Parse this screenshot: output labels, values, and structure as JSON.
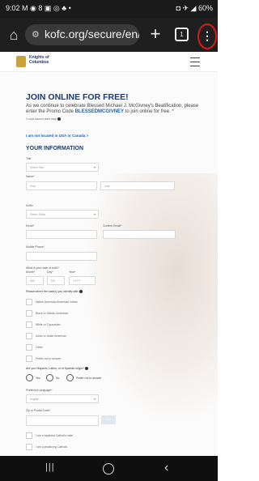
{
  "status_bar": {
    "time": "9:02",
    "left_icons": "M ◉ 8 ▣ ◎ ♣ •",
    "battery": "60%",
    "right_icons": "◘ ✈ ◢"
  },
  "browser": {
    "url": "kofc.org/secure/en/j",
    "url_icon": "site-settings-icon",
    "home_icon": "⌂",
    "new_tab": "+",
    "tab_count": "1",
    "menu": "⋮"
  },
  "site": {
    "logo_text": "Knights of\nColumbus"
  },
  "form": {
    "title": "JOIN ONLINE FOR FREE!",
    "intro_before": "As we continue to celebrate Blessed Michael J. McGivney's Beatification, please enter the Promo Code ",
    "promo_code": "BLESSEDMCGIVNEY",
    "intro_after": " to join online for free. *",
    "local_council_note": "*Local council dues may",
    "not_located_link": "I am not located in USA or Canada >",
    "section_title": "YOUR INFORMATION",
    "title_label": "Title",
    "title_select": "Select Title",
    "name_label": "Name",
    "first_placeholder": "First",
    "last_placeholder": "Last",
    "suffix_label": "Suffix",
    "suffix_select": "Select Suffix",
    "email_label": "Email",
    "confirm_email_label": "Confirm Email",
    "mobile_label": "Mobile Phone",
    "dob_label": "What is your date of birth?",
    "month_label": "Month",
    "day_label": "Day",
    "year_label": "Year",
    "month_placeholder": "MM",
    "day_placeholder": "DD",
    "year_placeholder": "YYYY",
    "race_question": "Please select the race(s) you identify with:",
    "race_options": [
      "Native American/American Indian",
      "Black or African-American",
      "White or Caucasian",
      "Asian or Asian American",
      "Other",
      "Prefer not to answer"
    ],
    "hispanic_question": "Are you Hispanic, Latino, or of Spanish origin?",
    "hispanic_options": [
      "Yes",
      "No",
      "Prefer not to answer"
    ],
    "language_label": "Preferred Language",
    "language_value": "English",
    "zip_label": "Zip or Postal Code",
    "go_button": "GO",
    "catholic_check_1": "I am a baptized Catholic male",
    "catholic_check_2": "I am a practicing Catholic"
  }
}
